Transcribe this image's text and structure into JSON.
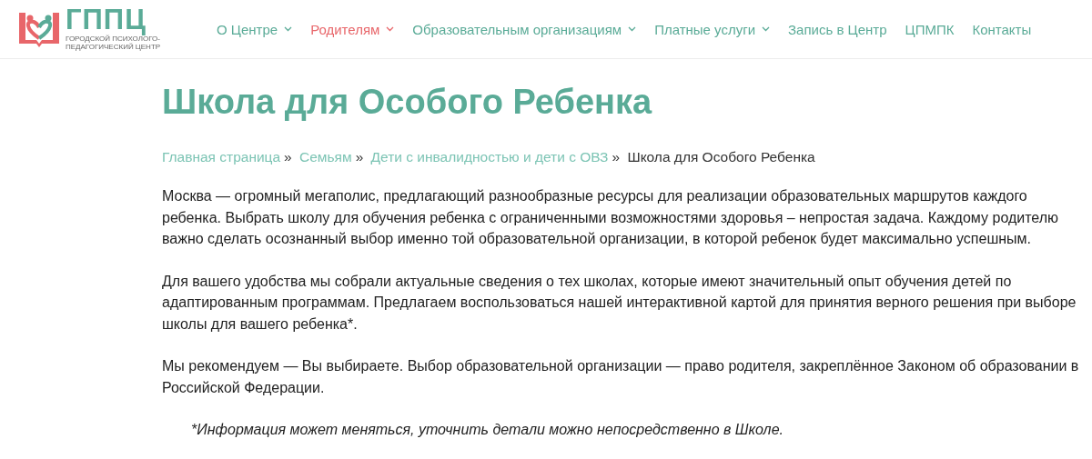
{
  "logo": {
    "name": "ГППЦ",
    "subtitle_lines": [
      "ГОРОДСКОЙ ПСИХОЛОГО-",
      "ПЕДАГОГИЧЕСКИЙ ЦЕНТР"
    ]
  },
  "nav": [
    {
      "label": "О Центре",
      "has_dropdown": true,
      "selected": false
    },
    {
      "label": "Родителям",
      "has_dropdown": true,
      "selected": true
    },
    {
      "label": "Образовательным организациям",
      "has_dropdown": true,
      "selected": false
    },
    {
      "label": "Платные услуги",
      "has_dropdown": true,
      "selected": false
    },
    {
      "label": "Запись в Центр",
      "has_dropdown": false,
      "selected": false
    },
    {
      "label": "ЦПМПК",
      "has_dropdown": false,
      "selected": false
    },
    {
      "label": "Контакты",
      "has_dropdown": false,
      "selected": false
    }
  ],
  "page_title": "Школа для Особого Ребенка",
  "breadcrumb_separator": "»",
  "breadcrumbs": [
    {
      "label": "Главная страница",
      "kind": "link"
    },
    {
      "label": "Семьям",
      "kind": "link"
    },
    {
      "label": "Дети с инвалидностью и дети с ОВЗ",
      "kind": "link"
    },
    {
      "label": "Школа для Особого Ребенка",
      "kind": "current"
    }
  ],
  "paragraphs": [
    "Москва — огромный мегаполис, предлагающий разнообразные ресурсы для реализации образовательных маршрутов каждого ребенка.  Выбрать школу для обучения ребенка с ограниченными возможностями здоровья – непростая задача. Каждому родителю важно сделать осознанный выбор именно той образовательной организации, в которой ребенок будет максимально успешным.",
    "Для вашего удобства мы собрали актуальные сведения о тех школах, которые имеют значительный опыт обучения детей по адаптированным программам.  Предлагаем воспользоваться нашей интерактивной картой для принятия верного решения при выборе школы для вашего ребенка*.",
    "Мы рекомендуем — Вы выбираете. Выбор образовательной организации — право родителя, закреплённое Законом об образовании в Российской Федерации."
  ],
  "note": "*Информация может меняться, уточнить детали можно непосредственно в Школе."
}
